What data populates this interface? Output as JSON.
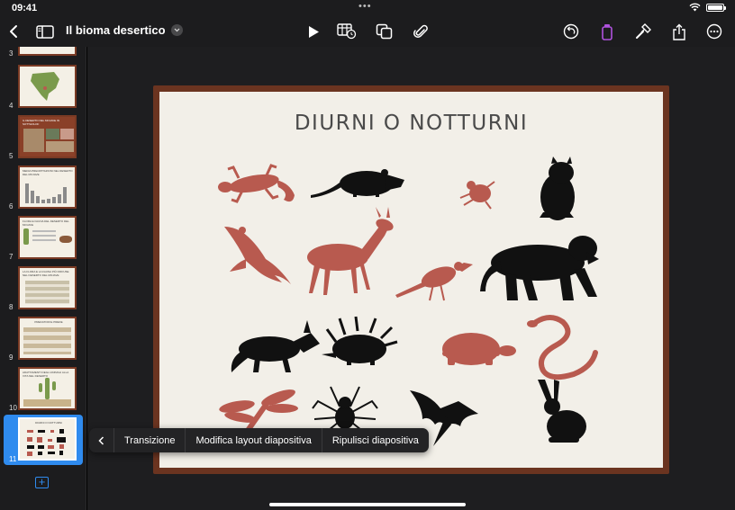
{
  "status": {
    "time": "09:41",
    "dots": "•••"
  },
  "toolbar": {
    "title": "Il bioma desertico",
    "colors": {
      "accent": "#af52de",
      "primary": "#2f8bef"
    }
  },
  "sidebar": {
    "slides": [
      {
        "number": "3",
        "title": ""
      },
      {
        "number": "4",
        "title": ""
      },
      {
        "number": "5",
        "title": "IL DESERTO DEL MOJAVE IN SOTTHOLOF"
      },
      {
        "number": "6",
        "title": "MEDIA PRECIPITAZIONI NEL DESERTO DEL MOJAVE"
      },
      {
        "number": "7",
        "title": "FLORA E FAUNA DEL DESERTO DEL MOJAVE"
      },
      {
        "number": "8",
        "title": "LA FLORA E LA FAUNA PIÙ DIFFUSE NEL DESERTO DEL MOJAVE"
      },
      {
        "number": "9",
        "title": "PREDATORI E PREDE"
      },
      {
        "number": "10",
        "title": "ADATTAMENTI DEGLI ANIMALI ALLA VITA NEL DESERTO"
      },
      {
        "number": "11",
        "title": "DIURNI O NOTTURNI"
      }
    ]
  },
  "slide": {
    "title": "DIURNI O NOTTURNI",
    "colors": {
      "frame": "#6b3420",
      "paper": "#f2efe8",
      "red": "#b85a4f",
      "black": "#111111"
    }
  },
  "context_menu": {
    "items": [
      "Transizione",
      "Modifica layout diapositiva",
      "Ripulisci diapositiva"
    ]
  }
}
